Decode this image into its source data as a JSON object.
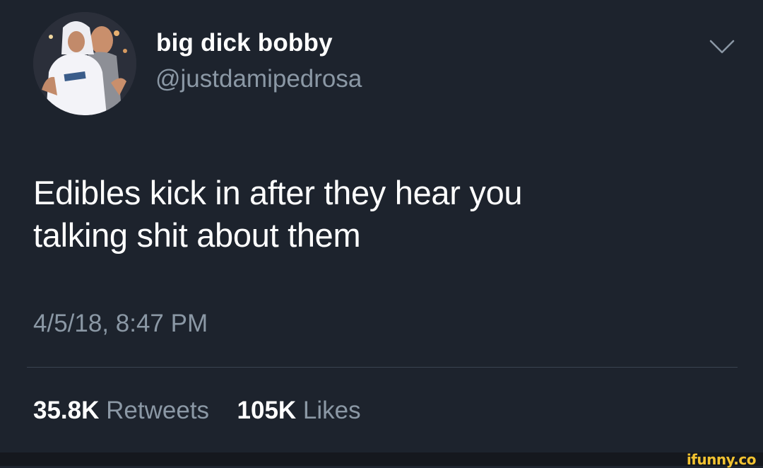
{
  "tweet": {
    "display_name": "big dick bobby",
    "handle": "@justdamipedrosa",
    "text_line1": "Edibles kick in after they hear you",
    "text_line2": "talking shit about them",
    "timestamp": "4/5/18, 8:47 PM",
    "retweets_count": "35.8K",
    "retweets_label": "Retweets",
    "likes_count": "105K",
    "likes_label": "Likes",
    "menu_icon": "chevron-down-icon"
  },
  "watermark": {
    "text": "ifunny.co"
  },
  "colors": {
    "background": "#1d232d",
    "primary_text": "#ffffff",
    "secondary_text": "#8b98a5",
    "divider": "#3a4350",
    "watermark": "#f2c230"
  }
}
